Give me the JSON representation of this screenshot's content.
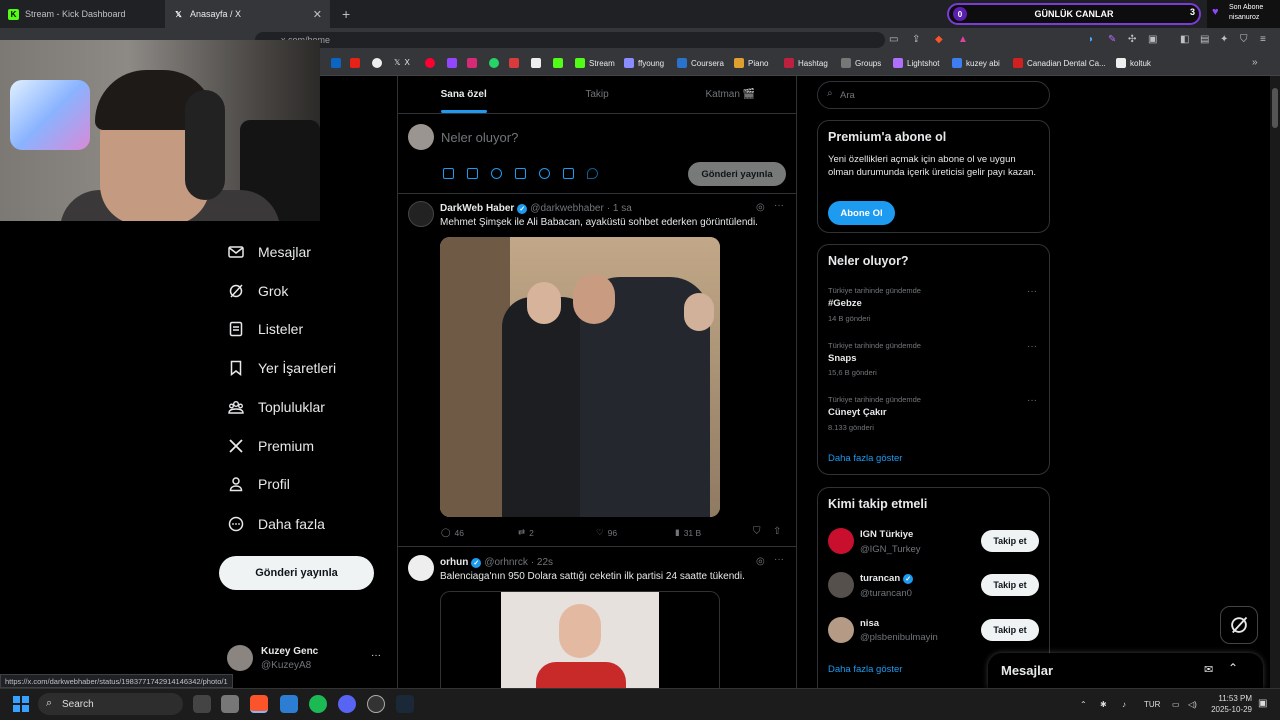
{
  "browser": {
    "tabs": [
      {
        "label": "Stream - Kick Dashboard",
        "icon": "kick-icon"
      },
      {
        "label": "Anasayfa / X",
        "icon": "x-icon"
      }
    ],
    "new_tab": "+",
    "url": "x.com/home",
    "bookmarks": [
      "X",
      "Stream",
      "ffyoung",
      "Coursera",
      "Piano",
      "Hashtag",
      "Groups",
      "Lightshot",
      "kuzey abi",
      "Canadian Dental Ca...",
      "koltuk"
    ],
    "status_url": "https://x.com/darkwebhaber/status/1983771742914146342/photo/1"
  },
  "overlay": {
    "counter_label": "GÜNLÜK CANLAR",
    "counter_left": "0",
    "counter_right": "3",
    "sub_title": "Son Abone",
    "sub_name": "nisanuroz"
  },
  "sidebar": {
    "items": [
      {
        "label": "Mesajlar",
        "icon": "mail-icon"
      },
      {
        "label": "Grok",
        "icon": "grok-icon"
      },
      {
        "label": "Listeler",
        "icon": "list-icon"
      },
      {
        "label": "Yer İşaretleri",
        "icon": "bookmark-icon"
      },
      {
        "label": "Topluluklar",
        "icon": "communities-icon"
      },
      {
        "label": "Premium",
        "icon": "x-logo-icon"
      },
      {
        "label": "Profil",
        "icon": "person-icon"
      },
      {
        "label": "Daha fazla",
        "icon": "more-circle-icon"
      }
    ],
    "post_button": "Gönderi yayınla",
    "user": {
      "name": "Kuzey Genc",
      "handle": "@KuzeyA8",
      "more": "···"
    }
  },
  "feed": {
    "tabs": [
      "Sana özel",
      "Takip",
      "Katman 🎬"
    ],
    "compose_placeholder": "Neler oluyor?",
    "compose_button": "Gönderi yayınla",
    "posts": [
      {
        "name": "DarkWeb Haber",
        "handle": "@darkwebhaber",
        "time": "· 1 sa",
        "text": "Mehmet Şimşek ile Ali Babacan, ayaküstü sohbet ederken görüntülendi.",
        "replies": "46",
        "reposts": "2",
        "likes": "96",
        "views": "31 B"
      },
      {
        "name": "orhun",
        "handle": "@orhnrck",
        "time": "· 22s",
        "text": "Balenciaga'nın 950 Dolara sattığı ceketin ilk partisi 24 saatte tükendi."
      }
    ]
  },
  "right": {
    "search_placeholder": "Ara",
    "premium": {
      "title": "Premium'a abone ol",
      "text": "Yeni özellikleri açmak için abone ol ve uygun olman durumunda içerik üreticisi gelir payı kazan.",
      "button": "Abone Ol"
    },
    "trends": {
      "title": "Neler oluyor?",
      "items": [
        {
          "context": "Türkiye tarihinde gündemde",
          "tag": "#Gebze",
          "count": "14 B gönderi"
        },
        {
          "context": "Türkiye tarihinde gündemde",
          "tag": "Snaps",
          "count": "15,6 B gönderi"
        },
        {
          "context": "Türkiye tarihinde gündemde",
          "tag": "Cüneyt Çakır",
          "count": "8.133 gönderi"
        }
      ],
      "show_more": "Daha fazla göster"
    },
    "who_to_follow": {
      "title": "Kimi takip etmeli",
      "items": [
        {
          "name": "IGN Türkiye",
          "handle": "@IGN_Turkey",
          "button": "Takip et"
        },
        {
          "name": "turancan",
          "handle": "@turancan0",
          "button": "Takip et"
        },
        {
          "name": "nisa",
          "handle": "@plsbenibulmayin",
          "button": "Takip et"
        }
      ],
      "show_more": "Daha fazla göster"
    },
    "messages_dock": "Mesajlar"
  },
  "taskbar": {
    "search": "Search",
    "lang": "TUR",
    "time": "11:53 PM",
    "date": "2025-10-29"
  }
}
